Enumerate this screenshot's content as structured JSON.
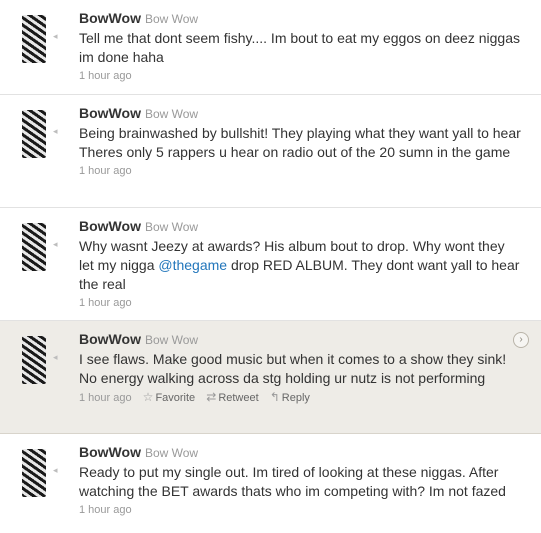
{
  "tweets": [
    {
      "screen_name": "BowWow",
      "full_name": "Bow Wow",
      "text_parts": [
        "Tell me that dont seem fishy.... Im bout to eat my eggos on deez niggas im done haha"
      ],
      "timestamp": "1 hour ago"
    },
    {
      "screen_name": "BowWow",
      "full_name": "Bow Wow",
      "text_parts": [
        "Being brainwashed by bullshit! They playing what they want yall to hear Theres only 5 rappers u hear on radio out of the 20 sumn in the game"
      ],
      "timestamp": "1 hour ago"
    },
    {
      "screen_name": "BowWow",
      "full_name": "Bow Wow",
      "text_before": "Why wasnt Jeezy at awards? His album bout to drop. Why wont they let my nigga ",
      "mention": "@thegame",
      "text_after": " drop RED ALBUM. They dont want yall to hear the real",
      "timestamp": "1 hour ago"
    },
    {
      "screen_name": "BowWow",
      "full_name": "Bow Wow",
      "text_parts": [
        "I see flaws. Make good music but when it comes to a show they sink! No energy walking across da stg holding ur nutz is not performing"
      ],
      "timestamp": "1 hour ago",
      "actions": {
        "favorite": "Favorite",
        "retweet": "Retweet",
        "reply": "Reply"
      },
      "hovered": true
    },
    {
      "screen_name": "BowWow",
      "full_name": "Bow Wow",
      "text_parts": [
        "Ready to put my single out. Im tired of looking at these niggas. After watching the BET awards thats who im competing with? Im not fazed"
      ],
      "timestamp": "1 hour ago"
    }
  ],
  "icons": {
    "avatar_mark": "◂",
    "favorite": "☆",
    "retweet": "⇄",
    "reply": "↰",
    "expand": "›"
  },
  "colors": {
    "hover_background": "#eeece7",
    "link": "#2276bb",
    "meta": "#999999"
  }
}
